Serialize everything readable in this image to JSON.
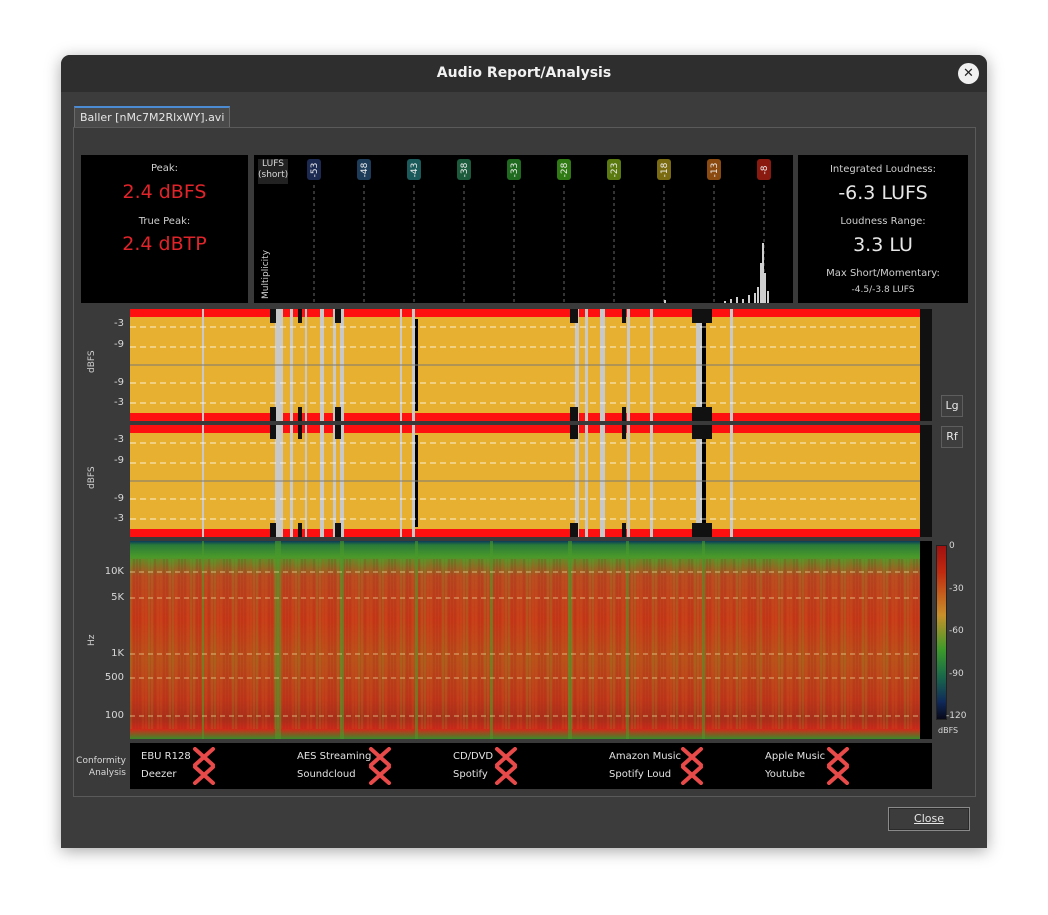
{
  "window": {
    "title": "Audio Report/Analysis",
    "close_glyph": "✕"
  },
  "tab": {
    "label": "Baller [nMc7M2RlxWY].avi"
  },
  "peak": {
    "peak_label": "Peak:",
    "peak_value": "2.4 dBFS",
    "true_peak_label": "True Peak:",
    "true_peak_value": "2.4 dBTP"
  },
  "histogram": {
    "unit_line1": "LUFS",
    "unit_line2": "(short)",
    "ylabel": "Multiplicity",
    "ticks": [
      "-53",
      "-48",
      "-43",
      "-38",
      "-33",
      "-28",
      "-23",
      "-18",
      "-13",
      "-8"
    ],
    "tick_colors": [
      "#1c2a52",
      "#1d3c5a",
      "#1b5a5a",
      "#1b5a3a",
      "#1e6a1e",
      "#2f7a12",
      "#5a7a10",
      "#7a6a10",
      "#8a4a10",
      "#8a1a10"
    ]
  },
  "loudness": {
    "integrated_label": "Integrated Loudness:",
    "integrated_value": "-6.3 LUFS",
    "range_label": "Loudness Range:",
    "range_value": "3.3 LU",
    "max_label": "Max Short/Momentary:",
    "max_value": "-4.5/-3.8 LUFS"
  },
  "waveform": {
    "axis_label": "dBFS",
    "ticks": [
      "-3",
      "-9",
      "-9",
      "-3"
    ],
    "colors": {
      "fill": "#e8b030",
      "clip": "#ff1010",
      "gap": "#c8c8c8"
    }
  },
  "side_buttons": {
    "lg": "Lg",
    "rf": "Rf"
  },
  "spectrogram": {
    "axis_label": "Hz",
    "ticks": [
      "10K",
      "5K",
      "1K",
      "500",
      "100"
    ],
    "scale_ticks": [
      "0",
      "-30",
      "-60",
      "-90",
      "-120"
    ],
    "scale_unit": "dBFS"
  },
  "conformity": {
    "label_line1": "Conformity",
    "label_line2": "Analysis",
    "items": [
      {
        "top": "EBU R128",
        "bottom": "Deezer"
      },
      {
        "top": "AES Streaming",
        "bottom": "Soundcloud"
      },
      {
        "top": "CD/DVD",
        "bottom": "Spotify"
      },
      {
        "top": "Amazon Music",
        "bottom": "Spotify Loud"
      },
      {
        "top": "Apple Music",
        "bottom": "Youtube"
      }
    ],
    "fail_icon": "red-x-icon"
  },
  "footer": {
    "close_label": "Close"
  }
}
